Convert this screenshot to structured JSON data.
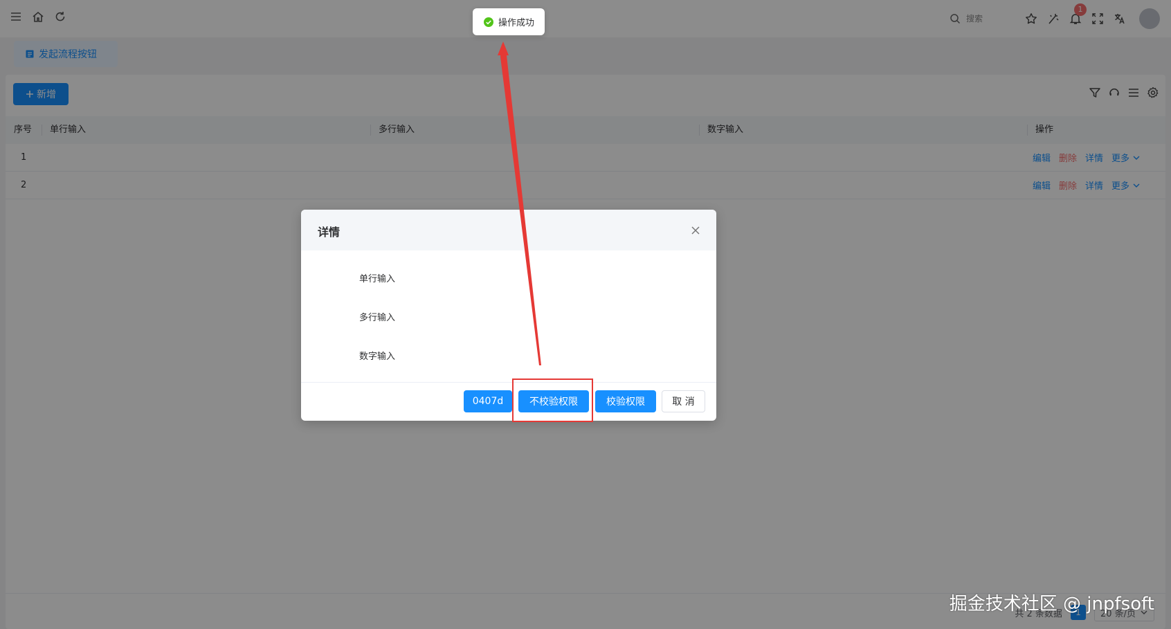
{
  "header": {
    "search_placeholder": "搜索",
    "notification_count": "1"
  },
  "tab": {
    "label": "发起流程按钮"
  },
  "toolbar": {
    "add_label": "新增"
  },
  "table": {
    "columns": [
      "序号",
      "单行输入",
      "多行输入",
      "数字输入",
      "操作"
    ],
    "rows": [
      {
        "index": "1"
      },
      {
        "index": "2"
      }
    ],
    "actions": {
      "edit": "编辑",
      "delete": "删除",
      "detail": "详情",
      "more": "更多"
    }
  },
  "pagination": {
    "total": "共 2 条数据",
    "current": "1",
    "page_size": "20 条/页"
  },
  "toast": {
    "message": "操作成功"
  },
  "dialog": {
    "title": "详情",
    "fields": [
      "单行输入",
      "多行输入",
      "数字输入"
    ],
    "buttons": {
      "custom": "0407d",
      "no_check": "不校验权限",
      "check": "校验权限",
      "cancel": "取 消"
    }
  },
  "watermark": "掘金技术社区 @ jnpfsoft",
  "colors": {
    "primary": "#1890ff",
    "danger": "#f56c6c",
    "annotation": "#e53935",
    "success": "#52c41a"
  }
}
